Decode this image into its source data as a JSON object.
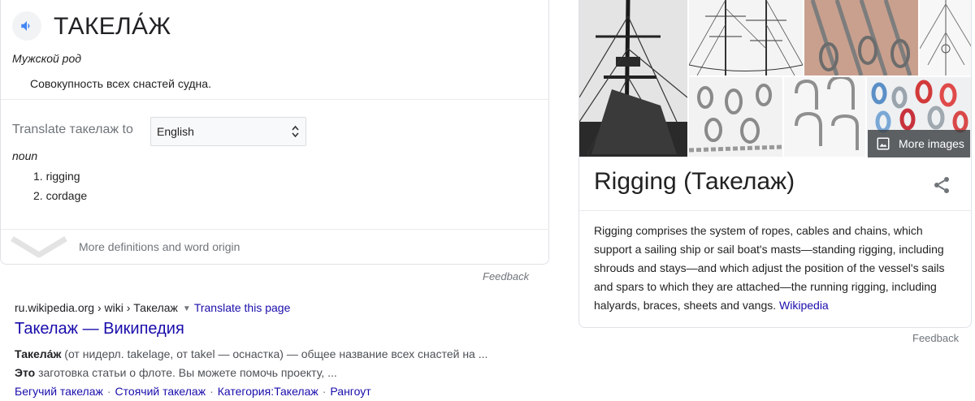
{
  "dictionary": {
    "headword": "ТАКЕЛА́Ж",
    "gender": "Мужской род",
    "definition": "Совокупность всех снастей судна.",
    "translate_label": "Translate такелаж to",
    "language_selected": "English",
    "part_of_speech": "noun",
    "translations": [
      "1. rigging",
      "2. cordage"
    ],
    "more_definitions": "More definitions and word origin",
    "feedback": "Feedback"
  },
  "result": {
    "url": "ru.wikipedia.org › wiki › Такелаж",
    "translate_link": "Translate this page",
    "title": "Такелаж — Википедия",
    "snippet1_bold": "Такела́ж",
    "snippet1_rest": " (от нидерл. takelage, от takel — оснастка) — общее название всех снастей на ...",
    "snippet2_bold": "Это",
    "snippet2_rest": " заготовка статьи о флоте. Вы можете помочь проекту, ...",
    "sitelinks": [
      "Бегучий такелаж",
      "Стоячий такелаж",
      "Категория:Такелаж",
      "Рангоут"
    ]
  },
  "knowledge_panel": {
    "more_images": "More images",
    "title": "Rigging (Такелаж)",
    "description": "Rigging comprises the system of ropes, cables and chains, which support a sailing ship or sail boat's masts—standing rigging, including shrouds and stays—and which adjust the position of the vessel's sails and spars to which they are attached—the running rigging, including halyards, braces, sheets and vangs.",
    "source_link": "Wikipedia",
    "feedback": "Feedback"
  },
  "icons": {
    "speaker": "speaker-icon",
    "select_arrows": "select-arrows-icon",
    "chevron": "chevron-down-icon",
    "images": "image-icon",
    "share": "share-icon"
  },
  "colors": {
    "link": "#1a0dab",
    "speaker": "#4285f4",
    "muted": "#70757a"
  }
}
